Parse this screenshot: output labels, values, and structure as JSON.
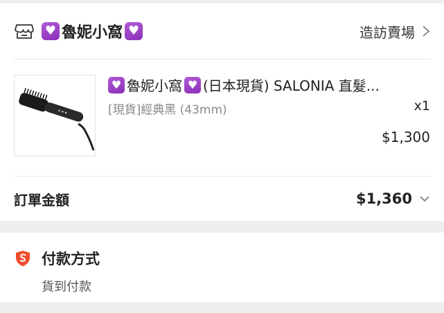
{
  "shop": {
    "name": "魯妮小窩",
    "visit_label": "造訪賣場"
  },
  "item": {
    "name_prefix": "魯妮小窩",
    "title": "(日本現貨) SALONIA 直髮...",
    "variant": "[現貨]經典黑 (43mm)",
    "quantity": "x1",
    "price": "$1,300"
  },
  "order": {
    "total_label": "訂單金額",
    "total_value": "$1,360"
  },
  "payment": {
    "title": "付款方式",
    "method": "貨到付款"
  },
  "colors": {
    "accent": "#ee4d2d",
    "heart": "#9b3fc7"
  }
}
